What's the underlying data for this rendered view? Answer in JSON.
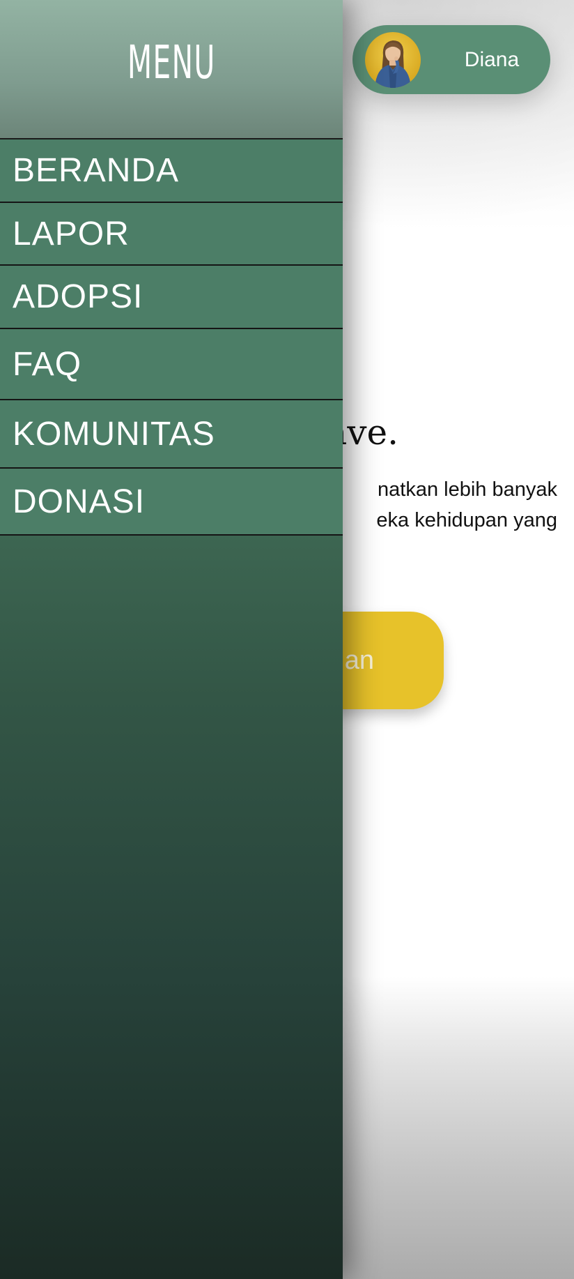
{
  "header": {
    "profile": {
      "name": "Diana"
    }
  },
  "hero": {
    "heading_visible": "ave.",
    "text_line1_visible": "natkan lebih banyak",
    "text_line2_visible": "eka kehidupan yang",
    "cta_label_visible": "an"
  },
  "drawer": {
    "title": "MENU",
    "items": [
      {
        "label": "BERANDA"
      },
      {
        "label": "LAPOR"
      },
      {
        "label": "ADOPSI"
      },
      {
        "label": "FAQ"
      },
      {
        "label": "KOMUNITAS"
      },
      {
        "label": "DONASI"
      }
    ]
  },
  "colors": {
    "brand_green": "#5a8f75",
    "drawer_item": "#4c7e67",
    "cta_yellow": "#e7c22a"
  },
  "icons": {
    "avatar": "user-photo-avatar"
  }
}
